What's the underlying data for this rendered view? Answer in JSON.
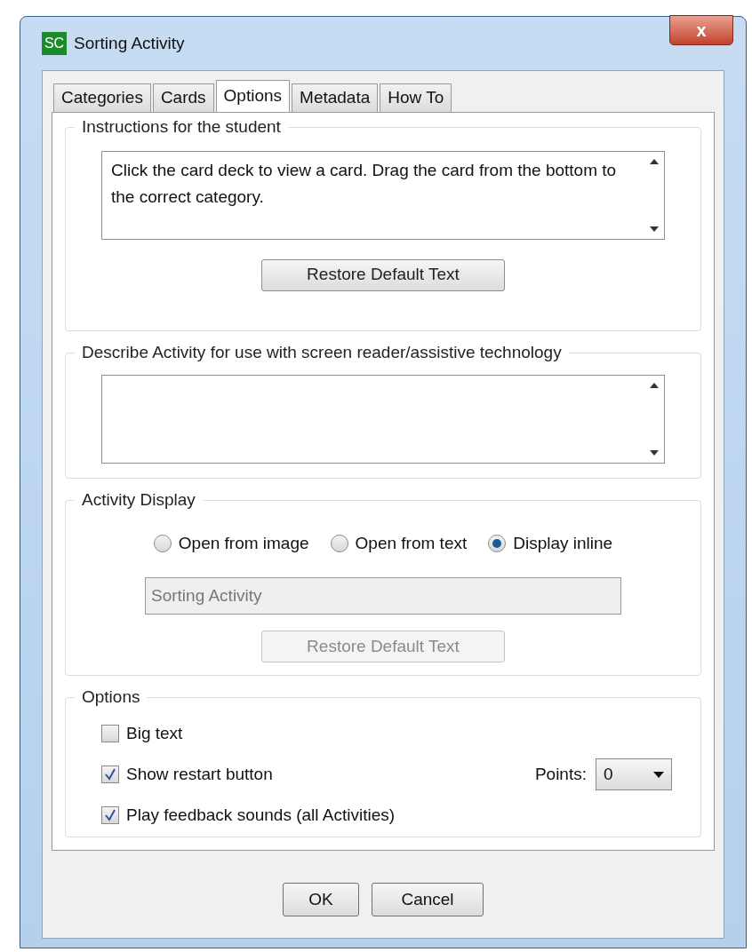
{
  "window": {
    "title": "Sorting Activity",
    "app_icon": "SC",
    "close": "x"
  },
  "tabs": [
    {
      "label": "Categories",
      "selected": false
    },
    {
      "label": "Cards",
      "selected": false
    },
    {
      "label": "Options",
      "selected": true
    },
    {
      "label": "Metadata",
      "selected": false
    },
    {
      "label": "How To",
      "selected": false
    }
  ],
  "instructions": {
    "title": "Instructions for the student",
    "text": "Click the card deck to view a card. Drag the card from the bottom to the correct category.",
    "button": {
      "label": "Restore Default Text",
      "disabled": false
    }
  },
  "describe": {
    "title": "Describe Activity for use with screen reader/assistive technology"
  },
  "display": {
    "title": "Activity Display",
    "radios": [
      {
        "label": "Open from image",
        "selected": false
      },
      {
        "label": "Open from text",
        "selected": false
      },
      {
        "label": "Display inline",
        "selected": true
      }
    ],
    "field": {
      "value": "Sorting Activity",
      "disabled": true
    },
    "button": {
      "label": "Restore Default Text",
      "disabled": true
    }
  },
  "options": {
    "title": "Options",
    "checkboxes": [
      {
        "label": "Big text",
        "checked": false
      },
      {
        "label": "Show restart button",
        "checked": true
      },
      {
        "label": "Play feedback sounds (all Activities)",
        "checked": true
      }
    ],
    "points": {
      "label": "Points:",
      "value": "0"
    }
  },
  "buttons": [
    "OK",
    "Cancel"
  ]
}
